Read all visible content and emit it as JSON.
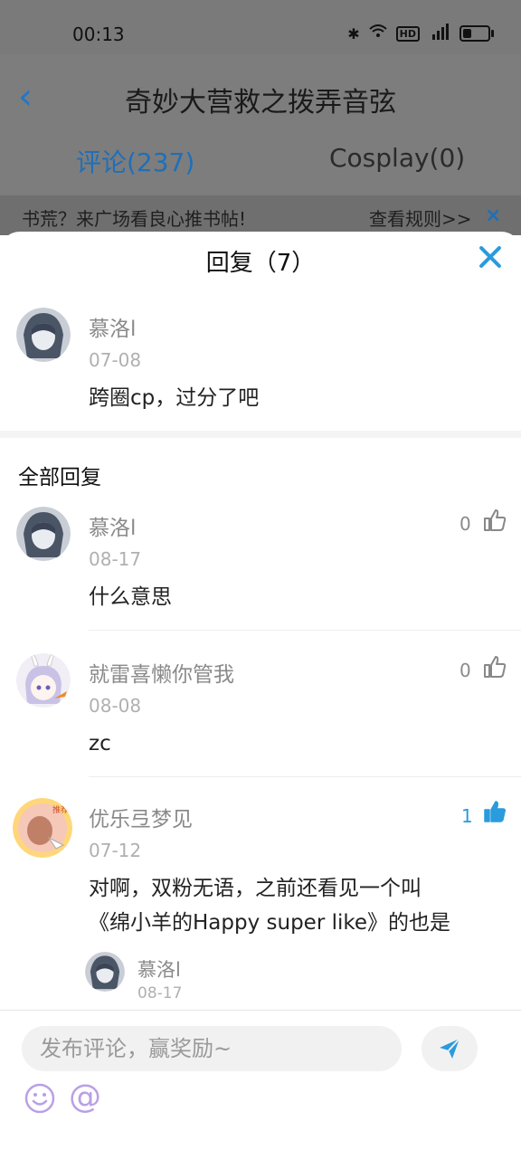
{
  "status_bar": {
    "time": "00:13",
    "icons": [
      "bluetooth-icon",
      "wifi-icon",
      "hd-icon",
      "5g-signal-icon",
      "battery-icon"
    ]
  },
  "app_bar": {
    "title": "奇妙大营救之拨弄音弦"
  },
  "tabs": [
    {
      "label": "评论(237)",
      "active": true
    },
    {
      "label": "Cosplay(0)",
      "active": false
    }
  ],
  "banner": {
    "text": "书荒？来广场看良心推书帖!",
    "link": "查看规则>>",
    "close": "×"
  },
  "sheet": {
    "title": "回复（7）",
    "original": {
      "name": "慕洛l",
      "date": "07-08",
      "text": "跨圈cp，过分了吧"
    },
    "section_title": "全部回复",
    "replies": [
      {
        "name": "慕洛l",
        "date": "08-17",
        "text": "什么意思",
        "likes": "0",
        "liked": false
      },
      {
        "name": "就雷喜懒你管我",
        "date": "08-08",
        "text": "zc",
        "likes": "0",
        "liked": false
      },
      {
        "name": "优乐弖梦见",
        "date": "07-12",
        "text_line1": "对啊，双粉无语，之前还看见一个叫",
        "text_line2": "《绵小羊的Happy super like》的也是",
        "likes": "1",
        "liked": true
      },
      {
        "name": "慕洛l",
        "date": "08-17",
        "partial": true
      }
    ]
  },
  "composer": {
    "placeholder": "发布评论，赢奖励~"
  },
  "colors": {
    "accent": "#2a9bdc",
    "tab_active": "#1f6fb8",
    "muted": "#8a8a8a"
  }
}
